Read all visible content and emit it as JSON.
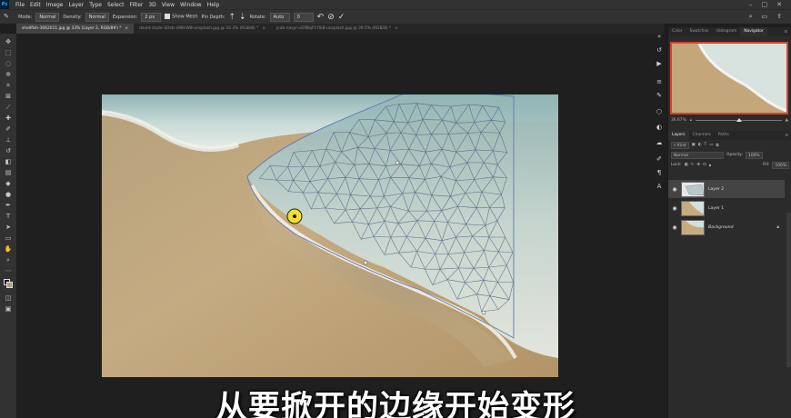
{
  "app": {
    "logo": "Ps"
  },
  "menu": [
    "File",
    "Edit",
    "Image",
    "Layer",
    "Type",
    "Select",
    "Filter",
    "3D",
    "View",
    "Window",
    "Help"
  ],
  "window_controls": [
    "–",
    "□",
    "✕"
  ],
  "options_bar": {
    "mode_label": "Mode:",
    "mode_value": "Normal",
    "density_label": "Density:",
    "density_value": "Normal",
    "expansion_label": "Expansion:",
    "expansion_value": "2 px",
    "show_mesh_label": "Show Mesh",
    "pin_depth_label": "Pin Depth:",
    "rotate_label": "Rotate:",
    "rotate_value": "Auto",
    "rotate_degrees": "0",
    "right_icons": [
      "search-icon",
      "workspace-icon",
      "share-icon"
    ]
  },
  "tabs": [
    {
      "label": "shellfish-3062011.jpg @ 33% (Layer 2, RGB/8#) *",
      "active": true
    },
    {
      "label": "david-clode-3Oxb-x9BnW8-unsplash.jpg @ 33.3% (RGB/8) *",
      "active": false
    },
    {
      "label": "jcob-nasyr-uGPBqF1Ylk8-unsplash.jpg @ 39.5% (RGB/8) *",
      "active": false
    }
  ],
  "panels": {
    "top_tabs": [
      "Color",
      "Swatches",
      "Histogram",
      "Navigator"
    ],
    "active_top_tab": "Navigator",
    "zoom": "36.67%",
    "layer_tabs": [
      "Layers",
      "Channels",
      "Paths"
    ],
    "active_layer_tab": "Layers",
    "kind_label": "Kind",
    "blend_mode": "Normal",
    "opacity_label": "Opacity:",
    "opacity_value": "100%",
    "lock_label": "Lock:",
    "fill_label": "Fill:",
    "fill_value": "100%"
  },
  "layers": [
    {
      "name": "Layer 2",
      "selected": true,
      "italic": false,
      "locked": false
    },
    {
      "name": "Layer 1",
      "selected": false,
      "italic": false,
      "locked": false
    },
    {
      "name": "Background",
      "selected": false,
      "italic": true,
      "locked": true
    }
  ],
  "subtitle": "从要掀开的边缘开始变形",
  "colors": {
    "accent_nav": "#d8412f",
    "panel_bg": "#2b2b2b",
    "canvas_bg": "#1f1f1f"
  }
}
